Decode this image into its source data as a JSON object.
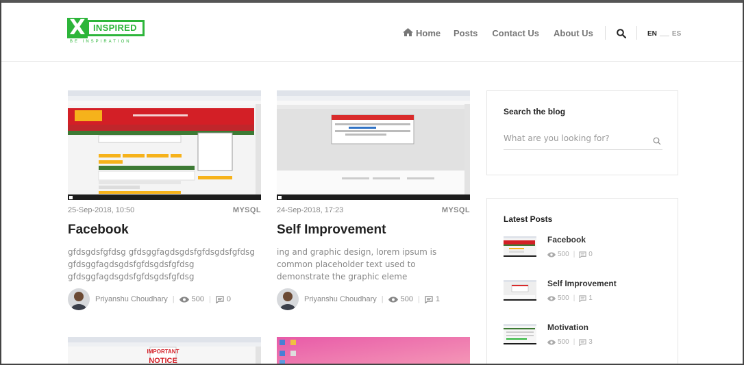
{
  "logo": {
    "letter": "X",
    "word": "INSPIRED",
    "tagline": "BE  INSPIRATION"
  },
  "nav": {
    "home": "Home",
    "posts": "Posts",
    "contact": "Contact Us",
    "about": "About Us",
    "lang_en": "EN",
    "lang_es": "ES"
  },
  "posts": [
    {
      "date": "25-Sep-2018, 10:50",
      "category": "MYSQL",
      "title": "Facebook",
      "excerpt": "gfdsgdsfgfdsg gfdsggfagdsgdsfgfdsgdsfgfdsg gfdsggfagdsgdsfgfdsgdsfgfdsg gfdsggfagdsgdsfgfdsgdsfgfdsg",
      "author": "Priyanshu Choudhary",
      "views": "500",
      "comments": "0"
    },
    {
      "date": "24-Sep-2018, 17:23",
      "category": "MYSQL",
      "title": "Self Improvement",
      "excerpt": "ing and graphic design, lorem ipsum is common placeholder text used to demonstrate the graphic eleme",
      "author": "Priyanshu Choudhary",
      "views": "500",
      "comments": "1"
    }
  ],
  "sidebar": {
    "search_title": "Search the blog",
    "search_placeholder": "What are you looking for?",
    "latest_title": "Latest Posts",
    "latest": [
      {
        "title": "Facebook",
        "views": "500",
        "comments": "0"
      },
      {
        "title": "Self Improvement",
        "views": "500",
        "comments": "1"
      },
      {
        "title": "Motivation",
        "views": "500",
        "comments": "3"
      }
    ]
  },
  "thumb_texts": {
    "important": "IMPORTANT",
    "notice": "NOTICE"
  },
  "colors": {
    "brand_green": "#2db53a",
    "text_dark": "#222222",
    "text_muted": "#888888"
  }
}
